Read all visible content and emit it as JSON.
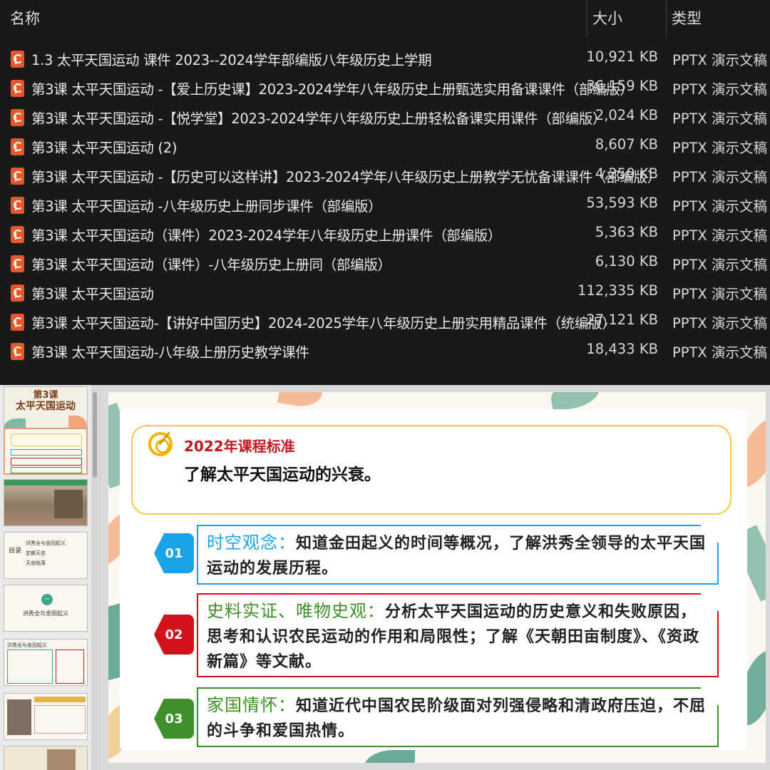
{
  "explorer": {
    "columns": {
      "name": "名称",
      "size": "大小",
      "type": "类型"
    },
    "files": [
      {
        "name": "1.3 太平天国运动 课件 2023--2024学年部编版八年级历史上学期",
        "size": "10,921 KB",
        "type": "PPTX 演示文稿"
      },
      {
        "name": "第3课  太平天国运动 -【爱上历史课】2023-2024学年八年级历史上册甄选实用备课课件（部编版）",
        "size": "36,159 KB",
        "type": "PPTX 演示文稿"
      },
      {
        "name": "第3课  太平天国运动 -【悦学堂】2023-2024学年八年级历史上册轻松备课实用课件（部编版）",
        "size": "2,024 KB",
        "type": "PPTX 演示文稿"
      },
      {
        "name": "第3课 太平天国运动 (2)",
        "size": "8,607 KB",
        "type": "PPTX 演示文稿"
      },
      {
        "name": "第3课 太平天国运动 -【历史可以这样讲】2023-2024学年八年级历史上册教学无忧备课课件（部编版）",
        "size": "4,250 KB",
        "type": "PPTX 演示文稿"
      },
      {
        "name": "第3课 太平天国运动 -八年级历史上册同步课件（部编版）",
        "size": "53,593 KB",
        "type": "PPTX 演示文稿"
      },
      {
        "name": "第3课 太平天国运动（课件）2023-2024学年八年级历史上册课件（部编版）",
        "size": "5,363 KB",
        "type": "PPTX 演示文稿"
      },
      {
        "name": "第3课 太平天国运动（课件）-八年级历史上册同（部编版）",
        "size": "6,130 KB",
        "type": "PPTX 演示文稿"
      },
      {
        "name": "第3课 太平天国运动",
        "size": "112,335 KB",
        "type": "PPTX 演示文稿"
      },
      {
        "name": "第3课 太平天国运动-【讲好中国历史】2024-2025学年八年级历史上册实用精品课件（统编版）",
        "size": "27,121 KB",
        "type": "PPTX 演示文稿"
      },
      {
        "name": "第3课 太平天国运动-八年级上册历史教学课件",
        "size": "18,433 KB",
        "type": "PPTX 演示文稿"
      }
    ]
  },
  "thumbnails": {
    "t1_title_line1": "第3课",
    "t1_title_line2": "太平天国运动",
    "t4_items": [
      "洪秀全与金田起义",
      "定都天京",
      "天京陷落"
    ],
    "t4_label": "目录",
    "t5_num": "一",
    "t5_title": "洪秀全与金田起义",
    "t6_title": "洪秀全与金田起义"
  },
  "slide": {
    "standard_title": "2022年课程标准",
    "standard_text": "了解太平天国运动的兴衰。",
    "items": [
      {
        "num": "01",
        "label": "时空观念：",
        "text": "知道金田起义的时间等概况，了解洪秀全领导的太平天国运动的发展历程。",
        "color": "#1aa3e8"
      },
      {
        "num": "02",
        "label": "史料实证、唯物史观：",
        "text": "分析太平天国运动的历史意义和失败原因，思考和认识农民运动的作用和局限性；了解《天朝田亩制度》、《资政新篇》等文献。",
        "color": "#d3111c"
      },
      {
        "num": "03",
        "label": "家国情怀：",
        "text": "知道近代中国农民阶级面对列强侵略和清政府压迫，不屈的斗争和爱国热情。",
        "color": "#3f8f2a"
      }
    ]
  }
}
